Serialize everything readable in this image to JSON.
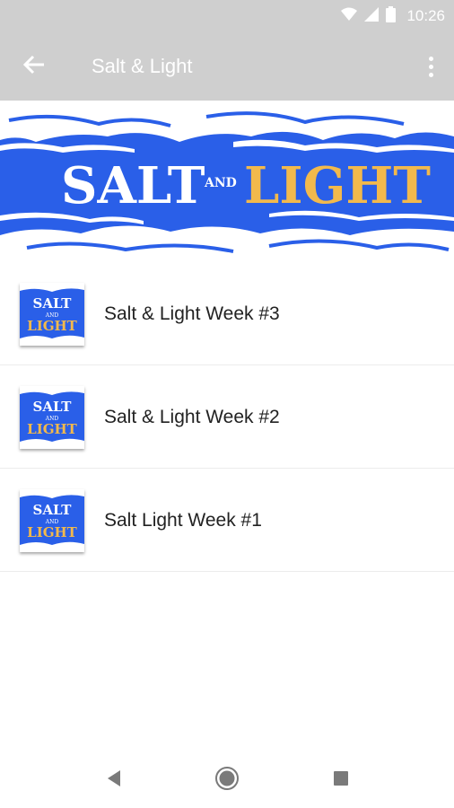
{
  "status_bar": {
    "time": "10:26"
  },
  "app_bar": {
    "title": "Salt & Light"
  },
  "banner": {
    "word_salt": "SALT",
    "word_and": "AND",
    "word_light": "LIGHT"
  },
  "thumb": {
    "word_salt": "SALT",
    "word_and": "AND",
    "word_light": "LIGHT"
  },
  "items": [
    {
      "title": "Salt & Light Week #3"
    },
    {
      "title": "Salt & Light Week #2"
    },
    {
      "title": "Salt Light Week #1"
    }
  ],
  "colors": {
    "bar": "#cfcfcf",
    "brand_blue": "#2a5fe8",
    "gold": "#f2b94c"
  }
}
